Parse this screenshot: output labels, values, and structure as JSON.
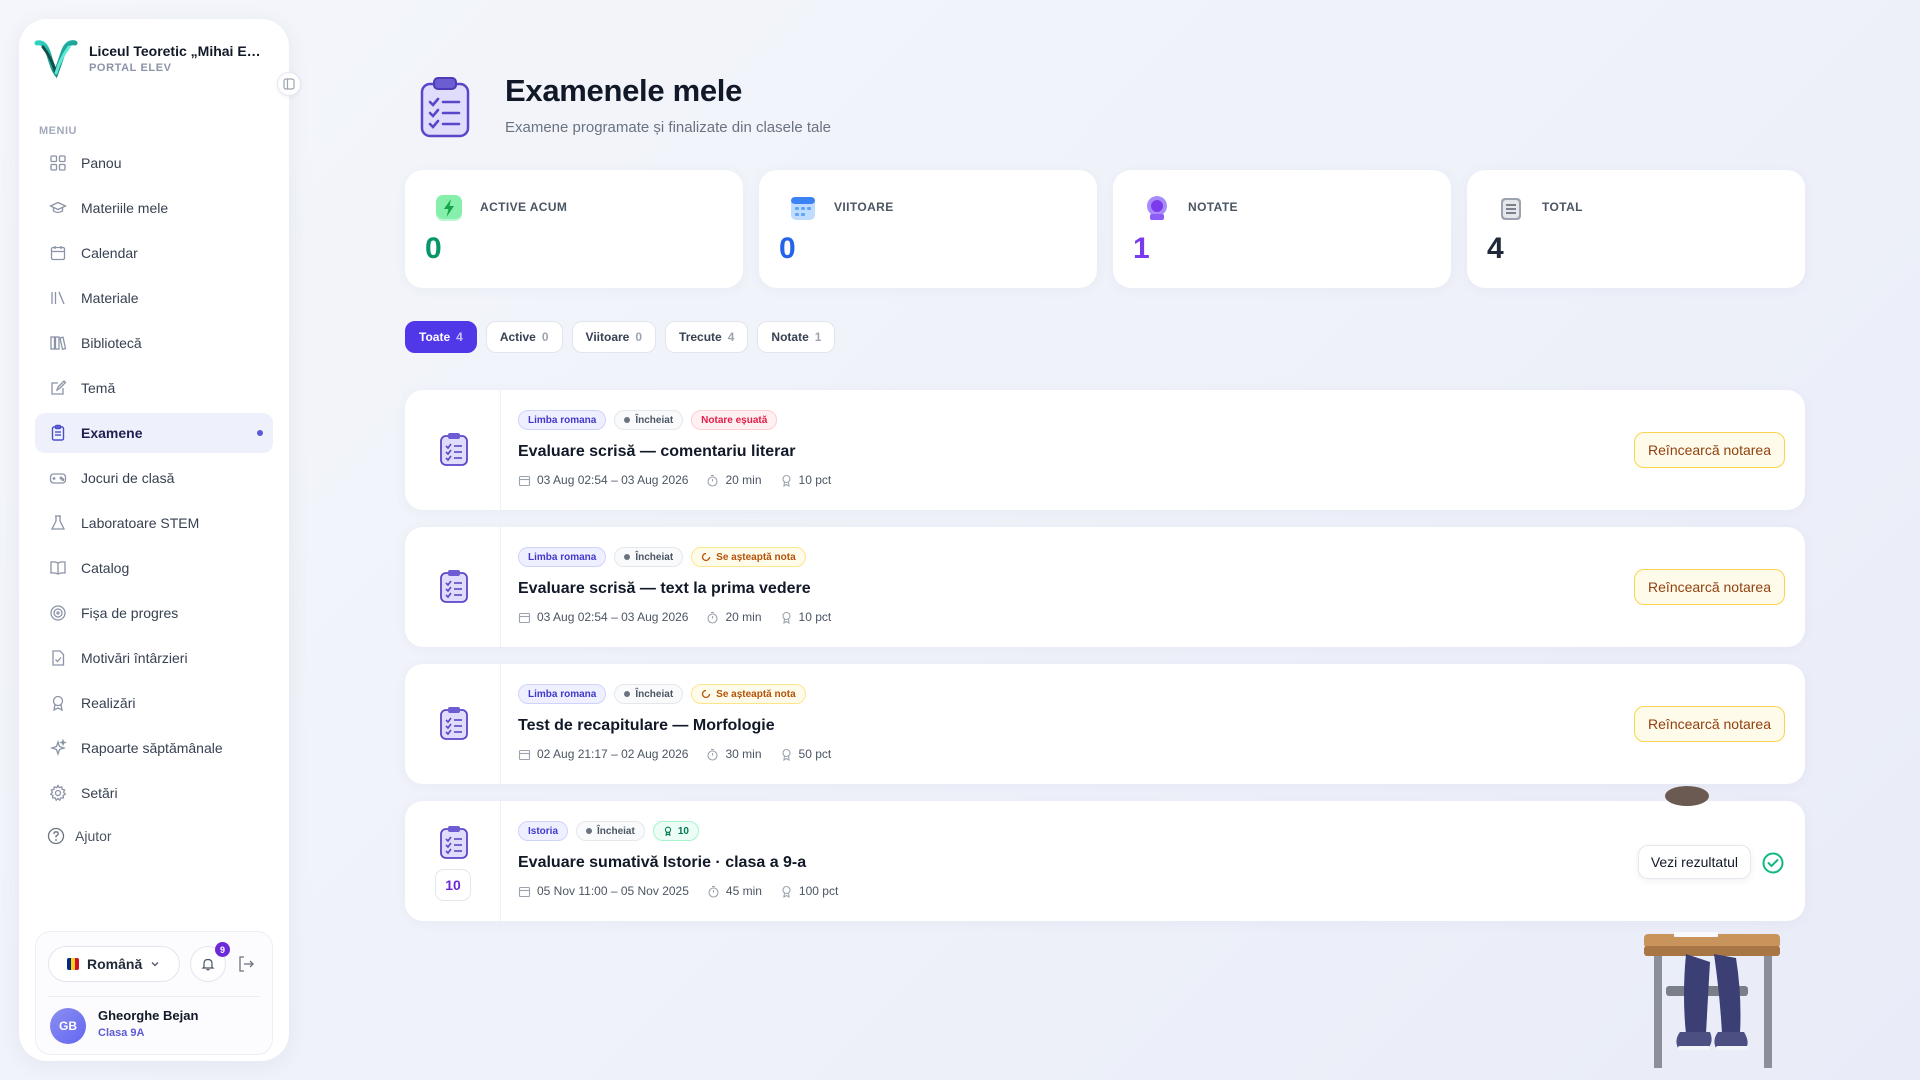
{
  "school": {
    "name": "Liceul Teoretic „Mihai Eminescu”",
    "portal": "PORTAL ELEV"
  },
  "menu": {
    "heading": "MENIU",
    "items": [
      {
        "label": "Panou",
        "icon": "grid-icon"
      },
      {
        "label": "Materiile mele",
        "icon": "graduation-cap-icon"
      },
      {
        "label": "Calendar",
        "icon": "calendar-icon"
      },
      {
        "label": "Materiale",
        "icon": "library-books-icon"
      },
      {
        "label": "Bibliotecă",
        "icon": "bookshelf-icon"
      },
      {
        "label": "Temă",
        "icon": "edit-note-icon"
      },
      {
        "label": "Examene",
        "icon": "clipboard-icon",
        "active": true
      },
      {
        "label": "Jocuri de clasă",
        "icon": "gamepad-icon"
      },
      {
        "label": "Laboratoare STEM",
        "icon": "flask-icon"
      },
      {
        "label": "Catalog",
        "icon": "open-book-icon"
      },
      {
        "label": "Fișa de progres",
        "icon": "target-icon"
      },
      {
        "label": "Motivări întârzieri",
        "icon": "file-check-icon"
      },
      {
        "label": "Realizări",
        "icon": "award-icon"
      },
      {
        "label": "Rapoarte săptămânale",
        "icon": "sparkles-icon"
      },
      {
        "label": "Setări",
        "icon": "gear-icon"
      }
    ],
    "help": "Ajutor"
  },
  "footer": {
    "language": "Română",
    "notifications": "9",
    "user": {
      "initials": "GB",
      "name": "Gheorghe Bejan",
      "class": "Clasa 9A"
    }
  },
  "page": {
    "title": "Examenele mele",
    "subtitle": "Examene programate și finalizate din clasele tale"
  },
  "stats": [
    {
      "label": "ACTIVE ACUM",
      "value": "0",
      "color": "#059669"
    },
    {
      "label": "VIITOARE",
      "value": "0",
      "color": "#2563eb"
    },
    {
      "label": "NOTATE",
      "value": "1",
      "color": "#7c3aed"
    },
    {
      "label": "TOTAL",
      "value": "4",
      "color": "#1f2937"
    }
  ],
  "tabs": [
    {
      "label": "Toate",
      "count": "4",
      "active": true
    },
    {
      "label": "Active",
      "count": "0"
    },
    {
      "label": "Viitoare",
      "count": "0"
    },
    {
      "label": "Trecute",
      "count": "4"
    },
    {
      "label": "Notate",
      "count": "1"
    }
  ],
  "exams": [
    {
      "subject": "Limba romana",
      "status": "Încheiat",
      "tag": {
        "type": "fail",
        "label": "Notare eșuată"
      },
      "title": "Evaluare scrisă — comentariu literar",
      "dates": "03 Aug 02:54 – 03 Aug 2026",
      "duration": "20 min",
      "points": "10 pct",
      "action": "Reîncearcă notarea"
    },
    {
      "subject": "Limba romana",
      "status": "Încheiat",
      "tag": {
        "type": "wait",
        "label": "Se așteaptă nota"
      },
      "title": "Evaluare scrisă — text la prima vedere",
      "dates": "03 Aug 02:54 – 03 Aug 2026",
      "duration": "20 min",
      "points": "10 pct",
      "action": "Reîncearcă notarea"
    },
    {
      "subject": "Limba romana",
      "status": "Încheiat",
      "tag": {
        "type": "wait",
        "label": "Se așteaptă nota"
      },
      "title": "Test de recapitulare — Morfologie",
      "dates": "02 Aug 21:17 – 02 Aug 2026",
      "duration": "30 min",
      "points": "50 pct",
      "action": "Reîncearcă notarea"
    },
    {
      "subject": "Istoria",
      "status": "Încheiat",
      "tag": {
        "type": "grade",
        "label": "10"
      },
      "score": "10",
      "title": "Evaluare sumativă Istorie · clasa a 9-a",
      "dates": "05 Nov 11:00 – 05 Nov 2025",
      "duration": "45 min",
      "points": "100 pct",
      "action": "Vezi rezultatul"
    }
  ]
}
